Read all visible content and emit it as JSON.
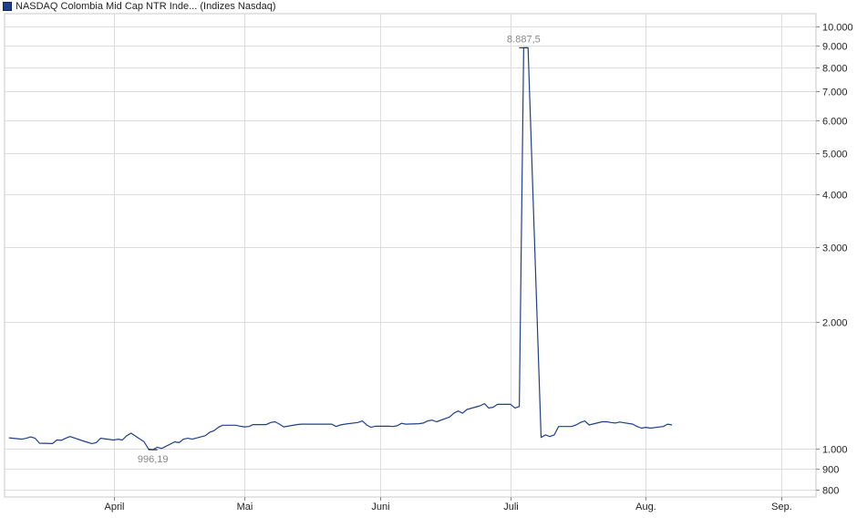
{
  "legend": {
    "label": "NASDAQ Colombia Mid Cap NTR Inde... (Indizes Nasdaq)",
    "color": "#1f3f8c"
  },
  "chart_data": {
    "type": "line",
    "title": "",
    "xlabel": "",
    "ylabel": "",
    "y_scale": "log",
    "ylim": [
      770,
      10700
    ],
    "grid": true,
    "line_color": "#1f3f8c",
    "x_tick_labels": [
      "April",
      "Mai",
      "Juni",
      "Juli",
      "Aug.",
      "Sep."
    ],
    "y_tick_values": [
      800,
      900,
      1000,
      2000,
      3000,
      4000,
      5000,
      6000,
      7000,
      8000,
      9000,
      10000
    ],
    "y_tick_labels": [
      "800",
      "900",
      "1.000",
      "2.000",
      "3.000",
      "4.000",
      "5.000",
      "6.000",
      "7.000",
      "8.000",
      "9.000",
      "10.000"
    ],
    "annotations": [
      {
        "label": "8.887,5",
        "value": 8887.5,
        "kind": "max"
      },
      {
        "label": "996,19",
        "value": 996.19,
        "kind": "min"
      }
    ],
    "series": [
      {
        "dates": [
          "2024-03-08",
          "2024-03-11",
          "2024-03-12",
          "2024-03-13",
          "2024-03-14",
          "2024-03-15",
          "2024-03-18",
          "2024-03-19",
          "2024-03-20",
          "2024-03-21",
          "2024-03-22",
          "2024-03-25",
          "2024-03-26",
          "2024-03-27",
          "2024-03-28",
          "2024-03-29",
          "2024-04-01",
          "2024-04-02",
          "2024-04-03",
          "2024-04-04",
          "2024-04-05",
          "2024-04-08",
          "2024-04-09",
          "2024-04-10",
          "2024-04-11",
          "2024-04-12",
          "2024-04-15",
          "2024-04-16",
          "2024-04-17",
          "2024-04-18",
          "2024-04-19",
          "2024-04-22",
          "2024-04-23",
          "2024-04-24",
          "2024-04-25",
          "2024-04-26",
          "2024-04-29",
          "2024-04-30",
          "2024-05-01",
          "2024-05-02",
          "2024-05-03",
          "2024-05-06",
          "2024-05-07",
          "2024-05-08",
          "2024-05-09",
          "2024-05-10",
          "2024-05-13",
          "2024-05-14",
          "2024-05-15",
          "2024-05-16",
          "2024-05-17",
          "2024-05-20",
          "2024-05-21",
          "2024-05-22",
          "2024-05-23",
          "2024-05-24",
          "2024-05-27",
          "2024-05-28",
          "2024-05-29",
          "2024-05-30",
          "2024-05-31",
          "2024-06-03",
          "2024-06-04",
          "2024-06-05",
          "2024-06-06",
          "2024-06-07",
          "2024-06-10",
          "2024-06-11",
          "2024-06-12",
          "2024-06-13",
          "2024-06-14",
          "2024-06-17",
          "2024-06-18",
          "2024-06-19",
          "2024-06-20",
          "2024-06-21",
          "2024-06-24",
          "2024-06-25",
          "2024-06-26",
          "2024-06-27",
          "2024-06-28",
          "2024-07-01",
          "2024-07-02",
          "2024-07-03",
          "2024-07-04",
          "2024-07-05",
          "2024-07-08",
          "2024-07-09",
          "2024-07-10",
          "2024-07-11",
          "2024-07-12",
          "2024-07-15",
          "2024-07-16",
          "2024-07-17",
          "2024-07-18",
          "2024-07-19",
          "2024-07-22",
          "2024-07-23",
          "2024-07-24",
          "2024-07-25",
          "2024-07-26",
          "2024-07-29",
          "2024-07-30",
          "2024-07-31",
          "2024-08-01",
          "2024-08-02",
          "2024-08-05",
          "2024-08-06",
          "2024-08-07",
          "2024-08-08",
          "2024-08-09",
          "2024-08-12",
          "2024-08-13",
          "2024-08-14",
          "2024-08-15",
          "2024-08-16",
          "2024-08-19",
          "2024-08-20",
          "2024-08-21",
          "2024-08-22",
          "2024-08-23",
          "2024-08-26",
          "2024-08-27",
          "2024-08-28",
          "2024-08-29",
          "2024-08-30",
          "2024-09-02",
          "2024-09-03",
          "2024-09-04",
          "2024-09-05",
          "2024-09-06"
        ],
        "values": [
          1063,
          1055,
          1060,
          1068,
          1060,
          1032,
          1030,
          1050,
          1048,
          1060,
          1070,
          1045,
          1037,
          1030,
          1035,
          1060,
          1050,
          1055,
          1050,
          1075,
          1090,
          1040,
          1000,
          996.19,
          1010,
          1003,
          1040,
          1035,
          1055,
          1060,
          1055,
          1075,
          1095,
          1105,
          1125,
          1138,
          1138,
          1132,
          1128,
          1130,
          1142,
          1142,
          1155,
          1160,
          1145,
          1128,
          1142,
          1145,
          1145,
          1145,
          1145,
          1145,
          1145,
          1130,
          1140,
          1145,
          1155,
          1165,
          1140,
          1125,
          1132,
          1132,
          1130,
          1135,
          1150,
          1145,
          1148,
          1152,
          1165,
          1170,
          1160,
          1190,
          1215,
          1230,
          1215,
          1240,
          1265,
          1280,
          1250,
          1255,
          1275,
          1275,
          1250,
          1260,
          8887.5,
          8887.5,
          1065,
          1080,
          1070,
          1080,
          1130,
          1130,
          1140,
          1155,
          1165,
          1140,
          1160,
          1160,
          1155,
          1152,
          1158,
          1145,
          1130,
          1120,
          1125,
          1120,
          1130,
          1145,
          1140
        ]
      }
    ]
  }
}
